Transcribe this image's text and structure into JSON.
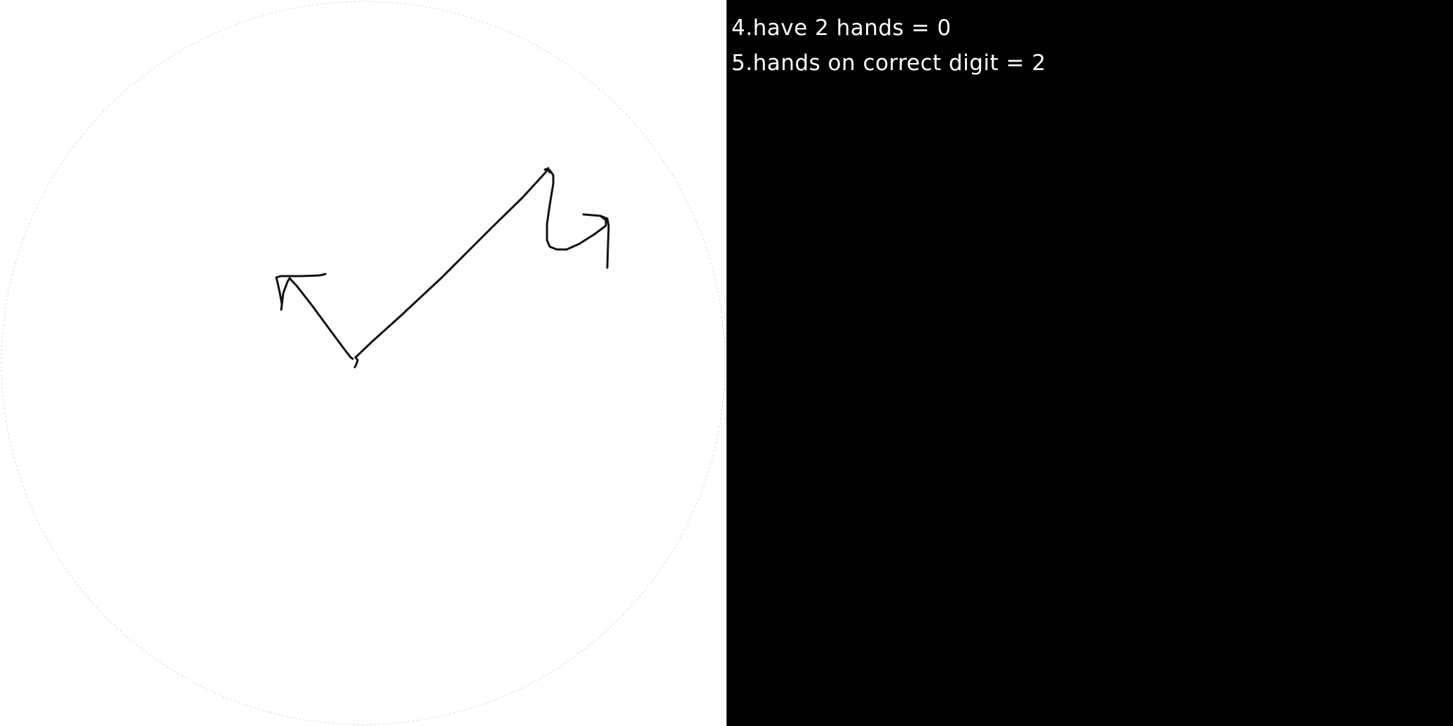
{
  "scores": [
    {
      "text": "4.have 2 hands = 0"
    },
    {
      "text": "5.hands on correct digit = 2"
    }
  ],
  "colors": {
    "drawing_background": "#ffffff",
    "score_background": "#000000",
    "score_text": "#ffffff",
    "stroke": "#111111",
    "clock_outline": "#e6e6e6"
  }
}
